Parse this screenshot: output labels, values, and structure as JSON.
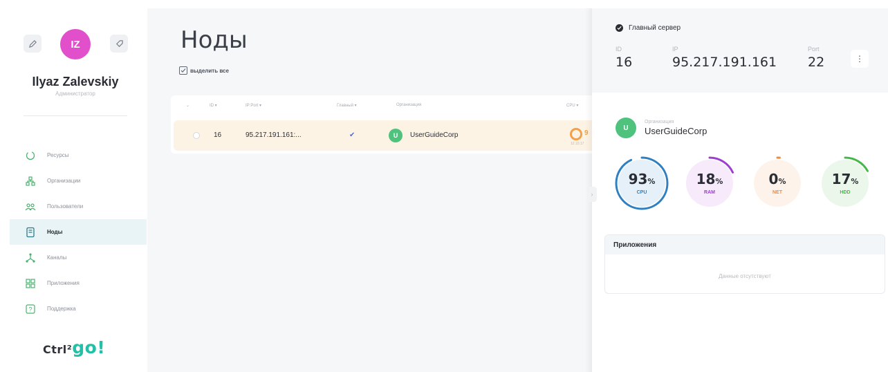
{
  "sidebar": {
    "user": {
      "initials": "IZ",
      "name": "Ilyaz Zalevskiy",
      "role": "Администратор"
    },
    "items": [
      {
        "label": "Ресурсы",
        "icon": "resources-icon",
        "active": false
      },
      {
        "label": "Организации",
        "icon": "organizations-icon",
        "active": false
      },
      {
        "label": "Пользователи",
        "icon": "users-icon",
        "active": false
      },
      {
        "label": "Ноды",
        "icon": "nodes-icon",
        "active": true
      },
      {
        "label": "Каналы",
        "icon": "channels-icon",
        "active": false
      },
      {
        "label": "Приложения",
        "icon": "apps-icon",
        "active": false
      },
      {
        "label": "Поддержка",
        "icon": "support-icon",
        "active": false
      }
    ],
    "logo": {
      "pre": "Ctrl²",
      "go": "go!"
    }
  },
  "main": {
    "title": "Ноды",
    "select_all": "выделить все",
    "table": {
      "columns": [
        "ID ▾",
        "IP:Port ▾",
        "Главный ▾",
        "Организация",
        "CPU ▾"
      ],
      "rows": [
        {
          "id": "16",
          "ip_port": "95.217.191.161:...",
          "is_main": "✔",
          "org_initial": "U",
          "org": "UserGuideCorp",
          "cpu": "9",
          "cpu_sub": "12.10.17"
        }
      ]
    }
  },
  "panel": {
    "main_server_label": "Главный сервер",
    "id_label": "ID",
    "id": "16",
    "ip_label": "IP",
    "ip": "95.217.191.161",
    "port_label": "Port",
    "port": "22",
    "more": "⋮",
    "collapse": "›",
    "org_label": "Организация",
    "org_initial": "U",
    "org_name": "UserGuideCorp",
    "gauges": [
      {
        "value": "93",
        "unit": "%",
        "label": "CPU",
        "percent": 93,
        "color": "#2f7fc1",
        "bg": "#e6f0f8"
      },
      {
        "value": "18",
        "unit": "%",
        "label": "RAM",
        "percent": 18,
        "color": "#9b3fd0",
        "bg": "#f6eafb"
      },
      {
        "value": "0",
        "unit": "%",
        "label": "NET",
        "percent": 0,
        "color": "#f08a3a",
        "bg": "#fdf3ea"
      },
      {
        "value": "17",
        "unit": "%",
        "label": "HDD",
        "percent": 17,
        "color": "#46b84a",
        "bg": "#ecf7ec"
      }
    ],
    "apps_title": "Приложения",
    "apps_empty": "Данные отсутствуют"
  },
  "colors": {
    "accent": "#23bfa6",
    "avatar": "#e14fcb",
    "org_avatar": "#4fc27d",
    "active_nav_bg": "#e8f4f6",
    "row_highlight": "#fdf3e4"
  }
}
